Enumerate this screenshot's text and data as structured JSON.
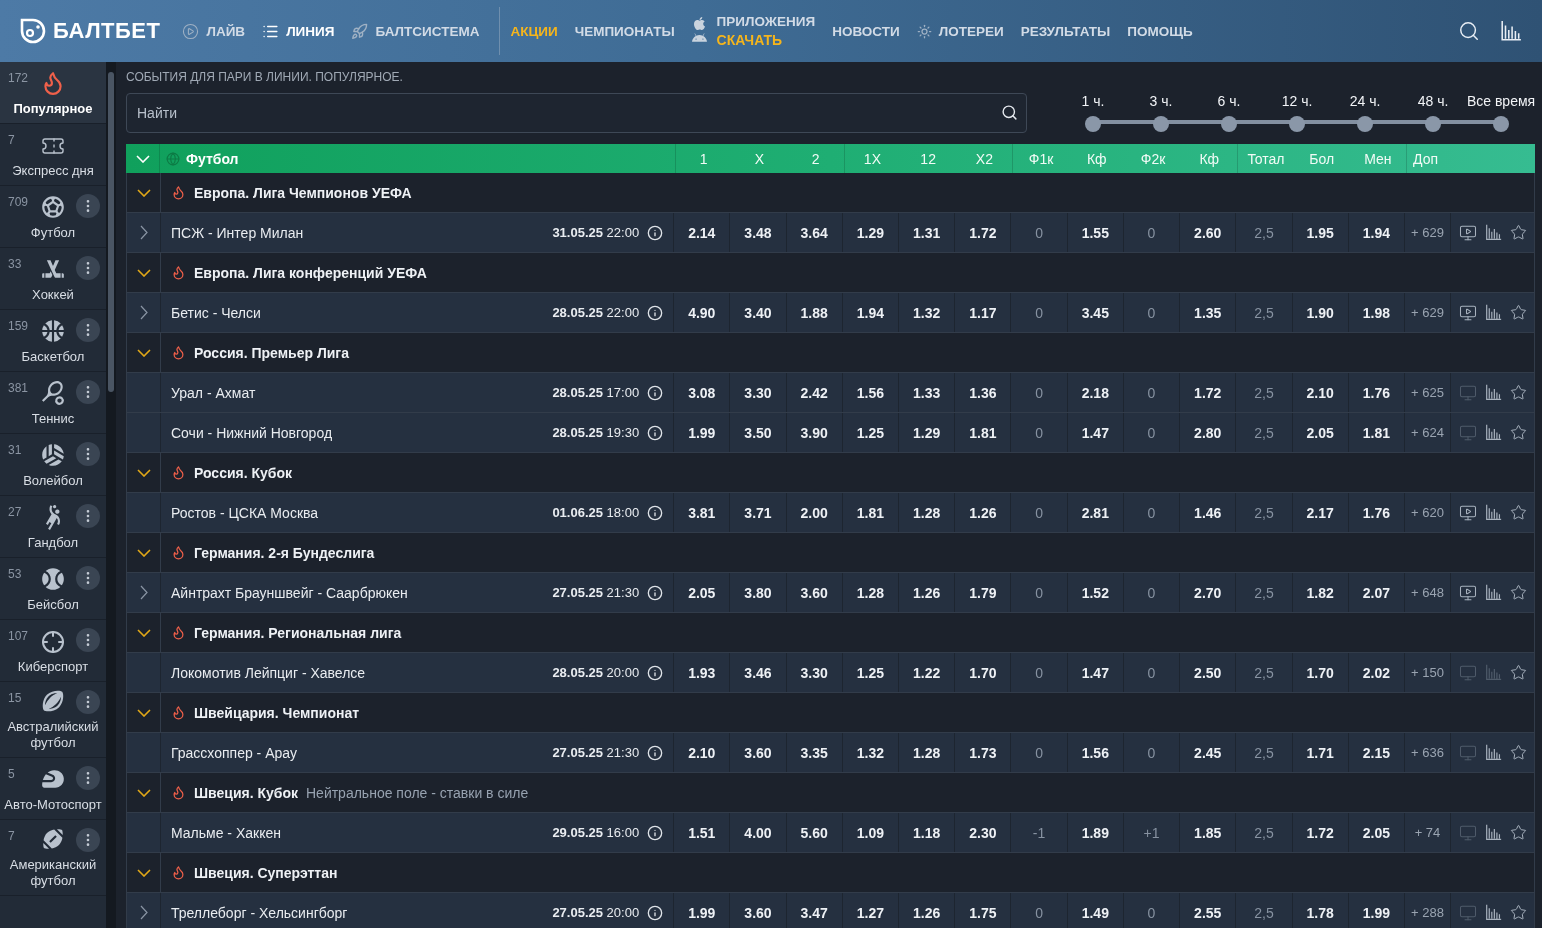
{
  "header": {
    "logo": "БАЛТБЕТ",
    "nav_primary": [
      {
        "label": "ЛАЙВ",
        "selected": false
      },
      {
        "label": "ЛИНИЯ",
        "selected": true
      },
      {
        "label": "БАЛТСИСТЕМА",
        "selected": false
      }
    ],
    "nav_secondary": [
      {
        "label": "АКЦИИ",
        "highlighted": true
      },
      {
        "label": "ЧЕМПИОНАТЫ",
        "highlighted": false
      },
      {
        "label": "ПРИЛОЖЕНИЯ",
        "sublabel": "СКАЧАТЬ",
        "highlighted": false
      },
      {
        "label": "НОВОСТИ",
        "highlighted": false
      },
      {
        "label": "ЛОТЕРЕИ",
        "highlighted": false
      },
      {
        "label": "РЕЗУЛЬТАТЫ",
        "highlighted": false
      },
      {
        "label": "ПОМОЩЬ",
        "highlighted": false
      }
    ]
  },
  "sidebar": {
    "items": [
      {
        "count": "172",
        "label": "Популярное",
        "selected": true,
        "menu": false
      },
      {
        "count": "7",
        "label": "Экспресс дня",
        "selected": false,
        "menu": false
      },
      {
        "count": "709",
        "label": "Футбол",
        "selected": false,
        "menu": true
      },
      {
        "count": "33",
        "label": "Хоккей",
        "selected": false,
        "menu": true
      },
      {
        "count": "159",
        "label": "Баскетбол",
        "selected": false,
        "menu": true
      },
      {
        "count": "381",
        "label": "Теннис",
        "selected": false,
        "menu": true
      },
      {
        "count": "31",
        "label": "Волейбол",
        "selected": false,
        "menu": true
      },
      {
        "count": "27",
        "label": "Гандбол",
        "selected": false,
        "menu": true
      },
      {
        "count": "53",
        "label": "Бейсбол",
        "selected": false,
        "menu": true
      },
      {
        "count": "107",
        "label": "Киберспорт",
        "selected": false,
        "menu": true
      },
      {
        "count": "15",
        "label": "Австралийский футбол",
        "selected": false,
        "menu": true
      },
      {
        "count": "5",
        "label": "Авто-Мотоспорт",
        "selected": false,
        "menu": true
      },
      {
        "count": "7",
        "label": "Американский футбол",
        "selected": false,
        "menu": true
      }
    ]
  },
  "breadcrumb": "СОБЫТИЯ ДЛЯ ПАРИ В ЛИНИИ. ПОПУЛЯРНОЕ.",
  "search": {
    "placeholder": "Найти"
  },
  "time_filter": {
    "labels": [
      "1 ч.",
      "3 ч.",
      "6 ч.",
      "12 ч.",
      "24 ч.",
      "48 ч.",
      "Все время"
    ]
  },
  "table": {
    "sport": {
      "label": "Футбол",
      "expanded": true
    },
    "column_groups": [
      [
        {
          "label": "1",
          "kind": "odd"
        },
        {
          "label": "X",
          "kind": "odd"
        },
        {
          "label": "2",
          "kind": "odd"
        }
      ],
      [
        {
          "label": "1X",
          "kind": "odd"
        },
        {
          "label": "12",
          "kind": "odd"
        },
        {
          "label": "X2",
          "kind": "odd"
        }
      ],
      [
        {
          "label": "Ф1к",
          "kind": "param"
        },
        {
          "label": "Кф",
          "kind": "odd"
        },
        {
          "label": "Ф2к",
          "kind": "param"
        },
        {
          "label": "Кф",
          "kind": "odd"
        }
      ],
      [
        {
          "label": "Тотал",
          "kind": "param"
        },
        {
          "label": "Бол",
          "kind": "odd"
        },
        {
          "label": "Мен",
          "kind": "odd"
        }
      ]
    ],
    "extra_label": "Доп",
    "leagues": [
      {
        "name": "Европа. Лига Чемпионов УЕФА",
        "expanded": true,
        "matches": [
          {
            "teams": "ПСЖ - Интер Милан",
            "date": "31.05.25",
            "time": "22:00",
            "expandable": true,
            "odds": [
              "2.14",
              "3.48",
              "3.64",
              "1.29",
              "1.31",
              "1.72",
              "0",
              "1.55",
              "0",
              "2.60",
              "2,5",
              "1.95",
              "1.94"
            ],
            "extra": "+ 629",
            "video": true,
            "stats": true
          }
        ]
      },
      {
        "name": "Европа. Лига конференций УЕФА",
        "expanded": true,
        "matches": [
          {
            "teams": "Бетис - Челси",
            "date": "28.05.25",
            "time": "22:00",
            "expandable": true,
            "odds": [
              "4.90",
              "3.40",
              "1.88",
              "1.94",
              "1.32",
              "1.17",
              "0",
              "3.45",
              "0",
              "1.35",
              "2,5",
              "1.90",
              "1.98"
            ],
            "extra": "+ 629",
            "video": true,
            "stats": true
          }
        ]
      },
      {
        "name": "Россия. Премьер Лига",
        "expanded": true,
        "matches": [
          {
            "teams": "Урал - Ахмат",
            "date": "28.05.25",
            "time": "17:00",
            "expandable": false,
            "odds": [
              "3.08",
              "3.30",
              "2.42",
              "1.56",
              "1.33",
              "1.36",
              "0",
              "2.18",
              "0",
              "1.72",
              "2,5",
              "2.10",
              "1.76"
            ],
            "extra": "+ 625",
            "video": false,
            "stats": true
          },
          {
            "teams": "Сочи - Нижний Новгород",
            "date": "28.05.25",
            "time": "19:30",
            "expandable": false,
            "odds": [
              "1.99",
              "3.50",
              "3.90",
              "1.25",
              "1.29",
              "1.81",
              "0",
              "1.47",
              "0",
              "2.80",
              "2,5",
              "2.05",
              "1.81"
            ],
            "extra": "+ 624",
            "video": false,
            "stats": true
          }
        ]
      },
      {
        "name": "Россия. Кубок",
        "expanded": true,
        "matches": [
          {
            "teams": "Ростов - ЦСКА Москва",
            "date": "01.06.25",
            "time": "18:00",
            "expandable": false,
            "odds": [
              "3.81",
              "3.71",
              "2.00",
              "1.81",
              "1.28",
              "1.26",
              "0",
              "2.81",
              "0",
              "1.46",
              "2,5",
              "2.17",
              "1.76"
            ],
            "extra": "+ 620",
            "video": true,
            "stats": true
          }
        ]
      },
      {
        "name": "Германия. 2-я Бундеслига",
        "expanded": true,
        "matches": [
          {
            "teams": "Айнтрахт Брауншвейг - Саарбрюкен",
            "date": "27.05.25",
            "time": "21:30",
            "expandable": true,
            "odds": [
              "2.05",
              "3.80",
              "3.60",
              "1.28",
              "1.26",
              "1.79",
              "0",
              "1.52",
              "0",
              "2.70",
              "2,5",
              "1.82",
              "2.07"
            ],
            "extra": "+ 648",
            "video": true,
            "stats": true
          }
        ]
      },
      {
        "name": "Германия. Региональная лига",
        "expanded": true,
        "matches": [
          {
            "teams": "Локомотив Лейпциг - Хавелсе",
            "date": "28.05.25",
            "time": "20:00",
            "expandable": false,
            "odds": [
              "1.93",
              "3.46",
              "3.30",
              "1.25",
              "1.22",
              "1.70",
              "0",
              "1.47",
              "0",
              "2.50",
              "2,5",
              "1.70",
              "2.02"
            ],
            "extra": "+ 150",
            "video": false,
            "stats": false
          }
        ]
      },
      {
        "name": "Швейцария. Чемпионат",
        "expanded": true,
        "matches": [
          {
            "teams": "Грассхоппер - Арау",
            "date": "27.05.25",
            "time": "21:30",
            "expandable": false,
            "odds": [
              "2.10",
              "3.60",
              "3.35",
              "1.32",
              "1.28",
              "1.73",
              "0",
              "1.56",
              "0",
              "2.45",
              "2,5",
              "1.71",
              "2.15"
            ],
            "extra": "+ 636",
            "video": false,
            "stats": true
          }
        ]
      },
      {
        "name": "Швеция. Кубок",
        "note": "Нейтральное поле - ставки в силе",
        "expanded": true,
        "matches": [
          {
            "teams": "Мальме - Хаккен",
            "date": "29.05.25",
            "time": "16:00",
            "expandable": false,
            "odds": [
              "1.51",
              "4.00",
              "5.60",
              "1.09",
              "1.18",
              "2.30",
              "-1",
              "1.89",
              "+1",
              "1.85",
              "2,5",
              "1.72",
              "2.05"
            ],
            "extra": "+ 74",
            "video": false,
            "stats": true
          }
        ]
      },
      {
        "name": "Швеция. Суперэттан",
        "expanded": true,
        "matches": [
          {
            "teams": "Треллеборг - Хельсингборг",
            "date": "27.05.25",
            "time": "20:00",
            "expandable": true,
            "odds": [
              "1.99",
              "3.60",
              "3.47",
              "1.27",
              "1.26",
              "1.75",
              "0",
              "1.49",
              "0",
              "2.55",
              "2,5",
              "1.78",
              "1.99"
            ],
            "extra": "+ 288",
            "video": false,
            "stats": true
          }
        ]
      }
    ]
  }
}
